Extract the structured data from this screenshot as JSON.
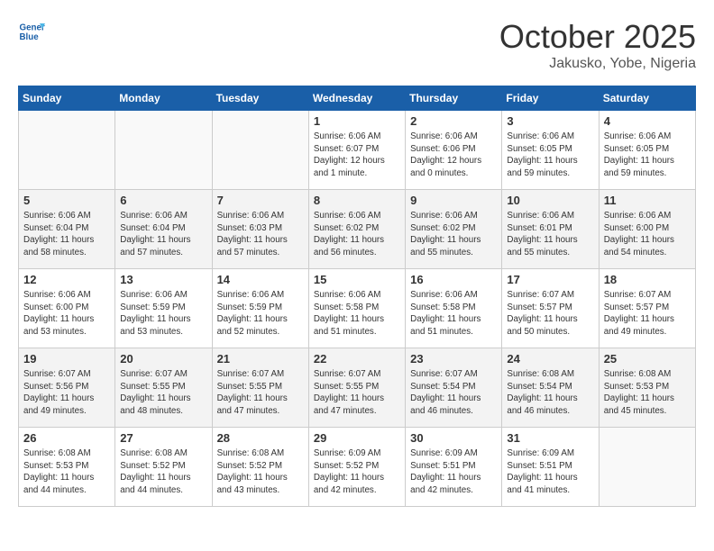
{
  "logo": {
    "line1": "General",
    "line2": "Blue"
  },
  "title": "October 2025",
  "subtitle": "Jakusko, Yobe, Nigeria",
  "days": [
    "Sunday",
    "Monday",
    "Tuesday",
    "Wednesday",
    "Thursday",
    "Friday",
    "Saturday"
  ],
  "weeks": [
    [
      {
        "date": "",
        "info": ""
      },
      {
        "date": "",
        "info": ""
      },
      {
        "date": "",
        "info": ""
      },
      {
        "date": "1",
        "info": "Sunrise: 6:06 AM\nSunset: 6:07 PM\nDaylight: 12 hours\nand 1 minute."
      },
      {
        "date": "2",
        "info": "Sunrise: 6:06 AM\nSunset: 6:06 PM\nDaylight: 12 hours\nand 0 minutes."
      },
      {
        "date": "3",
        "info": "Sunrise: 6:06 AM\nSunset: 6:05 PM\nDaylight: 11 hours\nand 59 minutes."
      },
      {
        "date": "4",
        "info": "Sunrise: 6:06 AM\nSunset: 6:05 PM\nDaylight: 11 hours\nand 59 minutes."
      }
    ],
    [
      {
        "date": "5",
        "info": "Sunrise: 6:06 AM\nSunset: 6:04 PM\nDaylight: 11 hours\nand 58 minutes."
      },
      {
        "date": "6",
        "info": "Sunrise: 6:06 AM\nSunset: 6:04 PM\nDaylight: 11 hours\nand 57 minutes."
      },
      {
        "date": "7",
        "info": "Sunrise: 6:06 AM\nSunset: 6:03 PM\nDaylight: 11 hours\nand 57 minutes."
      },
      {
        "date": "8",
        "info": "Sunrise: 6:06 AM\nSunset: 6:02 PM\nDaylight: 11 hours\nand 56 minutes."
      },
      {
        "date": "9",
        "info": "Sunrise: 6:06 AM\nSunset: 6:02 PM\nDaylight: 11 hours\nand 55 minutes."
      },
      {
        "date": "10",
        "info": "Sunrise: 6:06 AM\nSunset: 6:01 PM\nDaylight: 11 hours\nand 55 minutes."
      },
      {
        "date": "11",
        "info": "Sunrise: 6:06 AM\nSunset: 6:00 PM\nDaylight: 11 hours\nand 54 minutes."
      }
    ],
    [
      {
        "date": "12",
        "info": "Sunrise: 6:06 AM\nSunset: 6:00 PM\nDaylight: 11 hours\nand 53 minutes."
      },
      {
        "date": "13",
        "info": "Sunrise: 6:06 AM\nSunset: 5:59 PM\nDaylight: 11 hours\nand 53 minutes."
      },
      {
        "date": "14",
        "info": "Sunrise: 6:06 AM\nSunset: 5:59 PM\nDaylight: 11 hours\nand 52 minutes."
      },
      {
        "date": "15",
        "info": "Sunrise: 6:06 AM\nSunset: 5:58 PM\nDaylight: 11 hours\nand 51 minutes."
      },
      {
        "date": "16",
        "info": "Sunrise: 6:06 AM\nSunset: 5:58 PM\nDaylight: 11 hours\nand 51 minutes."
      },
      {
        "date": "17",
        "info": "Sunrise: 6:07 AM\nSunset: 5:57 PM\nDaylight: 11 hours\nand 50 minutes."
      },
      {
        "date": "18",
        "info": "Sunrise: 6:07 AM\nSunset: 5:57 PM\nDaylight: 11 hours\nand 49 minutes."
      }
    ],
    [
      {
        "date": "19",
        "info": "Sunrise: 6:07 AM\nSunset: 5:56 PM\nDaylight: 11 hours\nand 49 minutes."
      },
      {
        "date": "20",
        "info": "Sunrise: 6:07 AM\nSunset: 5:55 PM\nDaylight: 11 hours\nand 48 minutes."
      },
      {
        "date": "21",
        "info": "Sunrise: 6:07 AM\nSunset: 5:55 PM\nDaylight: 11 hours\nand 47 minutes."
      },
      {
        "date": "22",
        "info": "Sunrise: 6:07 AM\nSunset: 5:55 PM\nDaylight: 11 hours\nand 47 minutes."
      },
      {
        "date": "23",
        "info": "Sunrise: 6:07 AM\nSunset: 5:54 PM\nDaylight: 11 hours\nand 46 minutes."
      },
      {
        "date": "24",
        "info": "Sunrise: 6:08 AM\nSunset: 5:54 PM\nDaylight: 11 hours\nand 46 minutes."
      },
      {
        "date": "25",
        "info": "Sunrise: 6:08 AM\nSunset: 5:53 PM\nDaylight: 11 hours\nand 45 minutes."
      }
    ],
    [
      {
        "date": "26",
        "info": "Sunrise: 6:08 AM\nSunset: 5:53 PM\nDaylight: 11 hours\nand 44 minutes."
      },
      {
        "date": "27",
        "info": "Sunrise: 6:08 AM\nSunset: 5:52 PM\nDaylight: 11 hours\nand 44 minutes."
      },
      {
        "date": "28",
        "info": "Sunrise: 6:08 AM\nSunset: 5:52 PM\nDaylight: 11 hours\nand 43 minutes."
      },
      {
        "date": "29",
        "info": "Sunrise: 6:09 AM\nSunset: 5:52 PM\nDaylight: 11 hours\nand 42 minutes."
      },
      {
        "date": "30",
        "info": "Sunrise: 6:09 AM\nSunset: 5:51 PM\nDaylight: 11 hours\nand 42 minutes."
      },
      {
        "date": "31",
        "info": "Sunrise: 6:09 AM\nSunset: 5:51 PM\nDaylight: 11 hours\nand 41 minutes."
      },
      {
        "date": "",
        "info": ""
      }
    ]
  ]
}
